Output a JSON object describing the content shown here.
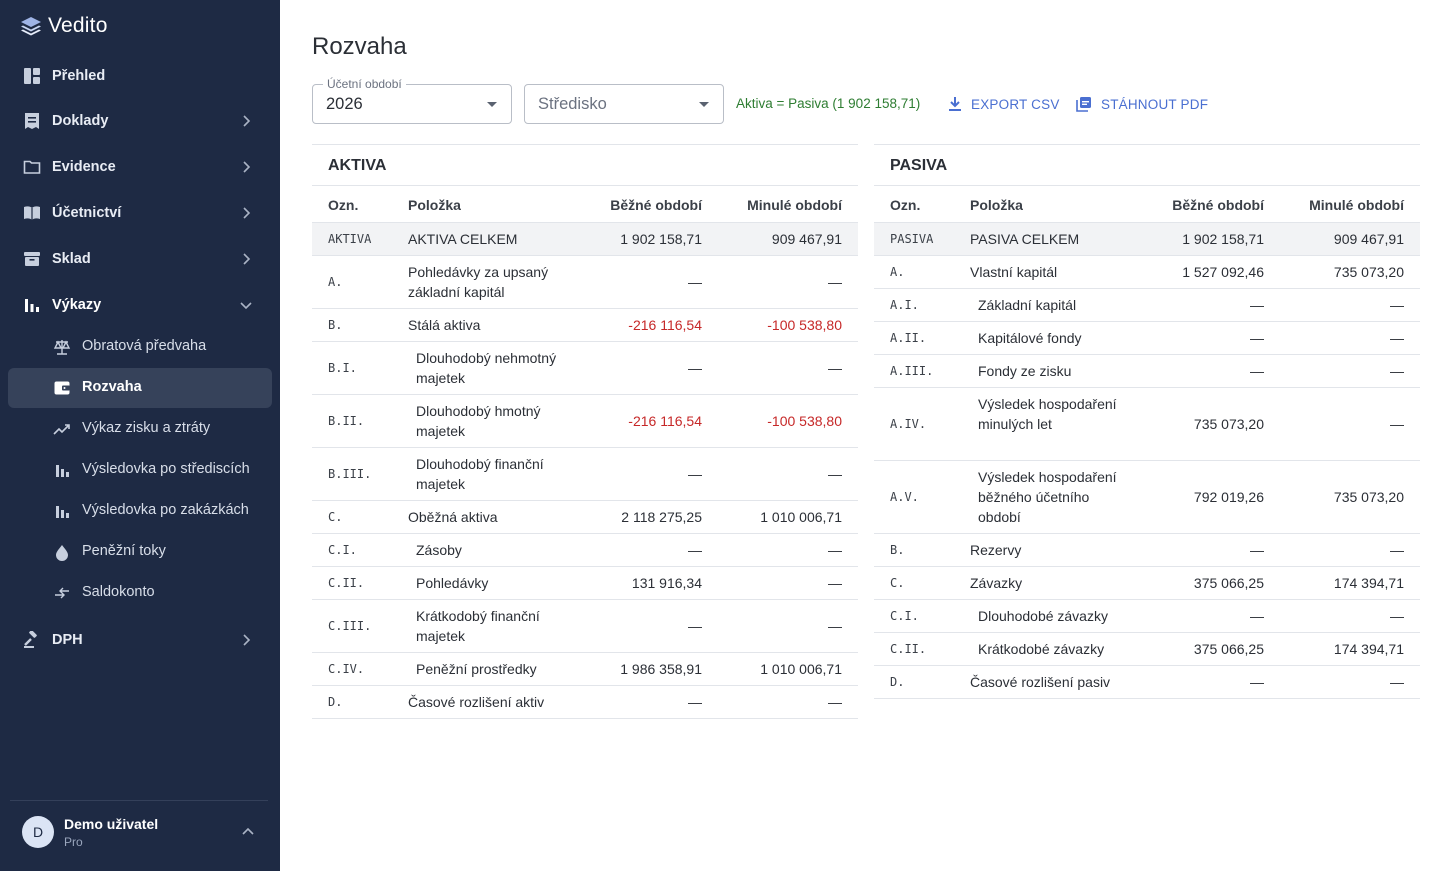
{
  "app": {
    "name": "Vedito"
  },
  "sidebar": {
    "items": [
      {
        "label": "Přehled",
        "icon": "dashboard-icon"
      },
      {
        "label": "Doklady",
        "icon": "receipt-icon"
      },
      {
        "label": "Evidence",
        "icon": "folder-icon"
      },
      {
        "label": "Účetnictví",
        "icon": "book-icon"
      },
      {
        "label": "Sklad",
        "icon": "warehouse-icon"
      },
      {
        "label": "Výkazy",
        "icon": "bar-chart-icon",
        "expanded": true
      },
      {
        "label": "DPH",
        "icon": "gavel-icon"
      }
    ],
    "subitems": [
      {
        "label": "Obratová předvaha",
        "icon": "scale-icon"
      },
      {
        "label": "Rozvaha",
        "icon": "wallet-icon",
        "active": true
      },
      {
        "label": "Výkaz zisku a ztráty",
        "icon": "trending-up-icon"
      },
      {
        "label": "Výsledovka po střediscích",
        "icon": "bar-chart-icon"
      },
      {
        "label": "Výsledovka po zakázkách",
        "icon": "bar-chart-icon"
      },
      {
        "label": "Peněžní toky",
        "icon": "drop-icon"
      },
      {
        "label": "Saldokonto",
        "icon": "compare-arrows-icon"
      }
    ],
    "user": {
      "initial": "D",
      "name": "Demo uživatel",
      "plan": "Pro"
    }
  },
  "page": {
    "title": "Rozvaha",
    "period": {
      "label": "Účetní období",
      "value": "2026"
    },
    "center": {
      "placeholder": "Středisko"
    },
    "balance_text": "Aktiva = Pasiva (1 902 158,71)",
    "export_csv": "EXPORT CSV",
    "download_pdf": "STÁHNOUT PDF"
  },
  "colors": {
    "sidebar": "#1e2a44",
    "accent": "#4a6fd1",
    "positive": "#2e7d32",
    "negative": "#c62828"
  },
  "aktiva": {
    "title": "AKTIVA",
    "headers": {
      "code": "Ozn.",
      "name": "Položka",
      "current": "Běžné období",
      "previous": "Minulé období"
    },
    "rows": [
      {
        "code": "AKTIVA",
        "name": "AKTIVA CELKEM",
        "current": "1 902 158,71",
        "previous": "909 467,91"
      },
      {
        "code": "A.",
        "name": "Pohledávky za upsaný základní kapitál",
        "current": "—",
        "previous": "—"
      },
      {
        "code": "B.",
        "name": "Stálá aktiva",
        "current": "-216 116,54",
        "previous": "-100 538,80"
      },
      {
        "code": "B.I.",
        "name": "Dlouhodobý nehmotný majetek",
        "current": "—",
        "previous": "—"
      },
      {
        "code": "B.II.",
        "name": "Dlouhodobý hmotný majetek",
        "current": "-216 116,54",
        "previous": "-100 538,80"
      },
      {
        "code": "B.III.",
        "name": "Dlouhodobý finanční majetek",
        "current": "—",
        "previous": "—"
      },
      {
        "code": "C.",
        "name": "Oběžná aktiva",
        "current": "2 118 275,25",
        "previous": "1 010 006,71"
      },
      {
        "code": "C.I.",
        "name": "Zásoby",
        "current": "—",
        "previous": "—"
      },
      {
        "code": "C.II.",
        "name": "Pohledávky",
        "current": "131 916,34",
        "previous": "—"
      },
      {
        "code": "C.III.",
        "name": "Krátkodobý finanční majetek",
        "current": "—",
        "previous": "—"
      },
      {
        "code": "C.IV.",
        "name": "Peněžní prostředky",
        "current": "1 986 358,91",
        "previous": "1 010 006,71"
      },
      {
        "code": "D.",
        "name": "Časové rozlišení aktiv",
        "current": "—",
        "previous": "—"
      }
    ]
  },
  "pasiva": {
    "title": "PASIVA",
    "headers": {
      "code": "Ozn.",
      "name": "Položka",
      "current": "Běžné období",
      "previous": "Minulé období"
    },
    "rows": [
      {
        "code": "PASIVA",
        "name": "PASIVA CELKEM",
        "current": "1 902 158,71",
        "previous": "909 467,91"
      },
      {
        "code": "A.",
        "name": "Vlastní kapitál",
        "current": "1 527 092,46",
        "previous": "735 073,20"
      },
      {
        "code": "A.I.",
        "name": "Základní kapitál",
        "current": "—",
        "previous": "—"
      },
      {
        "code": "A.II.",
        "name": "Kapitálové fondy",
        "current": "—",
        "previous": "—"
      },
      {
        "code": "A.III.",
        "name": "Fondy ze zisku",
        "current": "—",
        "previous": "—"
      },
      {
        "code": "A.IV.",
        "name": "Výsledek hospodaření minulých let",
        "current": "735 073,20",
        "previous": "—"
      },
      {
        "code": "A.V.",
        "name": "Výsledek hospodaření běžného účetního období",
        "current": "792 019,26",
        "previous": "735 073,20"
      },
      {
        "code": "B.",
        "name": "Rezervy",
        "current": "—",
        "previous": "—"
      },
      {
        "code": "C.",
        "name": "Závazky",
        "current": "375 066,25",
        "previous": "174 394,71"
      },
      {
        "code": "C.I.",
        "name": "Dlouhodobé závazky",
        "current": "—",
        "previous": "—"
      },
      {
        "code": "C.II.",
        "name": "Krátkodobé závazky",
        "current": "375 066,25",
        "previous": "174 394,71"
      },
      {
        "code": "D.",
        "name": "Časové rozlišení pasiv",
        "current": "—",
        "previous": "—"
      }
    ]
  }
}
